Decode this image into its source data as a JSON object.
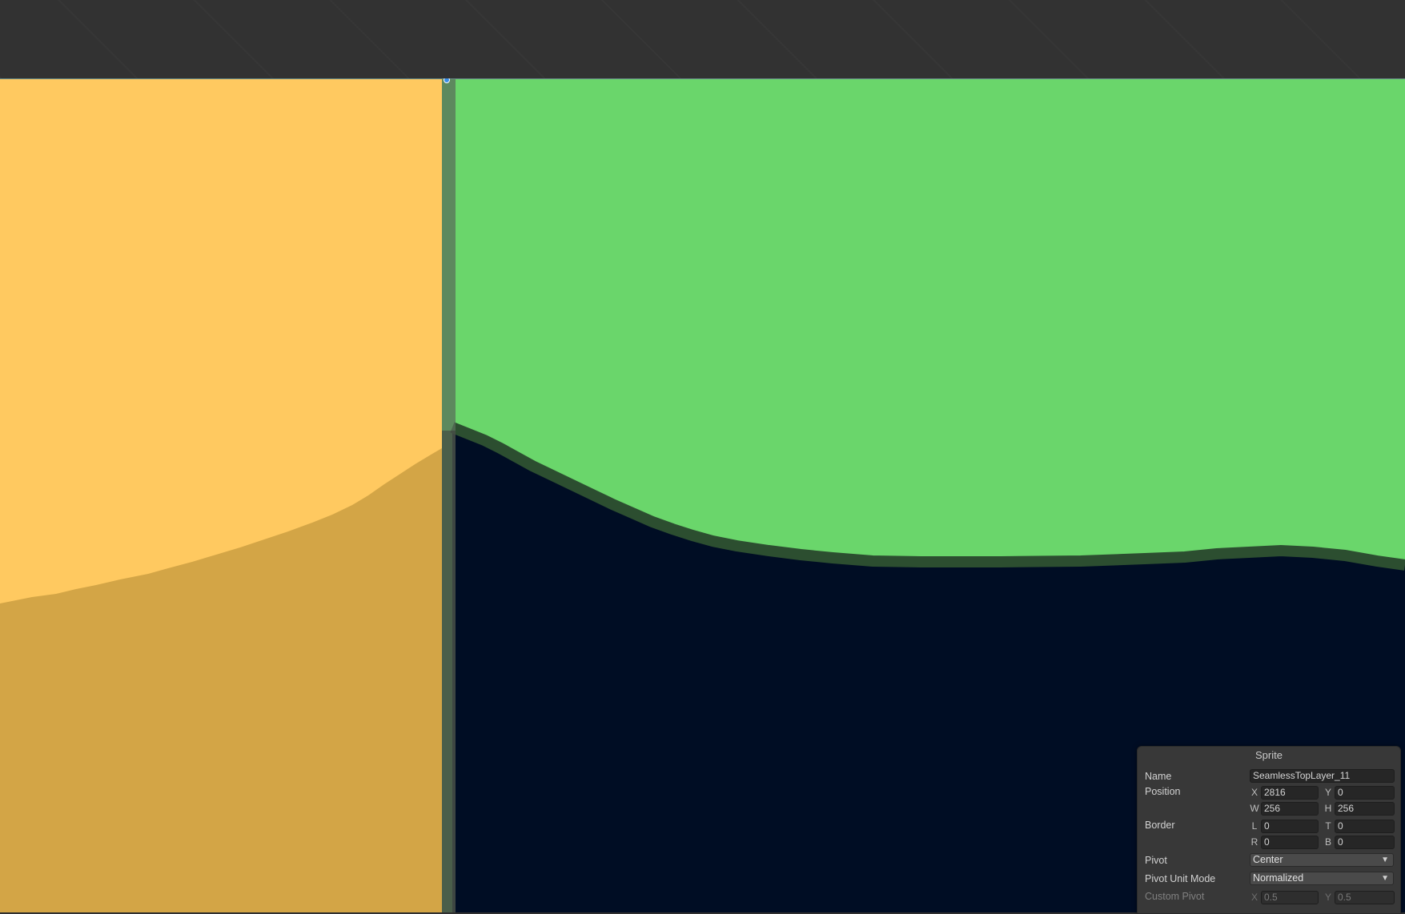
{
  "colors": {
    "editor_top": "#323232",
    "sand_light": "#FFC960",
    "sand_dark": "#D3A546",
    "grass": "#6AD66B",
    "grass_edge": "#2C4E30",
    "water": "#000D24",
    "divider": "#5A6F5A",
    "pivot_handle": "#3A8EE8"
  },
  "sprite_panel": {
    "title": "Sprite",
    "name_label": "Name",
    "name_value": "SeamlessTopLayer_11",
    "position_label": "Position",
    "x_axis": "X",
    "x_value": "2816",
    "y_axis": "Y",
    "y_value": "0",
    "w_axis": "W",
    "w_value": "256",
    "h_axis": "H",
    "h_value": "256",
    "border_label": "Border",
    "l_axis": "L",
    "l_value": "0",
    "t_axis": "T",
    "t_value": "0",
    "r_axis": "R",
    "r_value": "0",
    "b_axis": "B",
    "b_value": "0",
    "pivot_label": "Pivot",
    "pivot_value": "Center",
    "pivot_unit_mode_label": "Pivot Unit Mode",
    "pivot_unit_mode_value": "Normalized",
    "custom_pivot_label": "Custom Pivot",
    "custom_x_axis": "X",
    "custom_x_value": "0.5",
    "custom_y_axis": "Y",
    "custom_y_value": "0.5",
    "dropdown_icon": "chevron-down-icon"
  }
}
